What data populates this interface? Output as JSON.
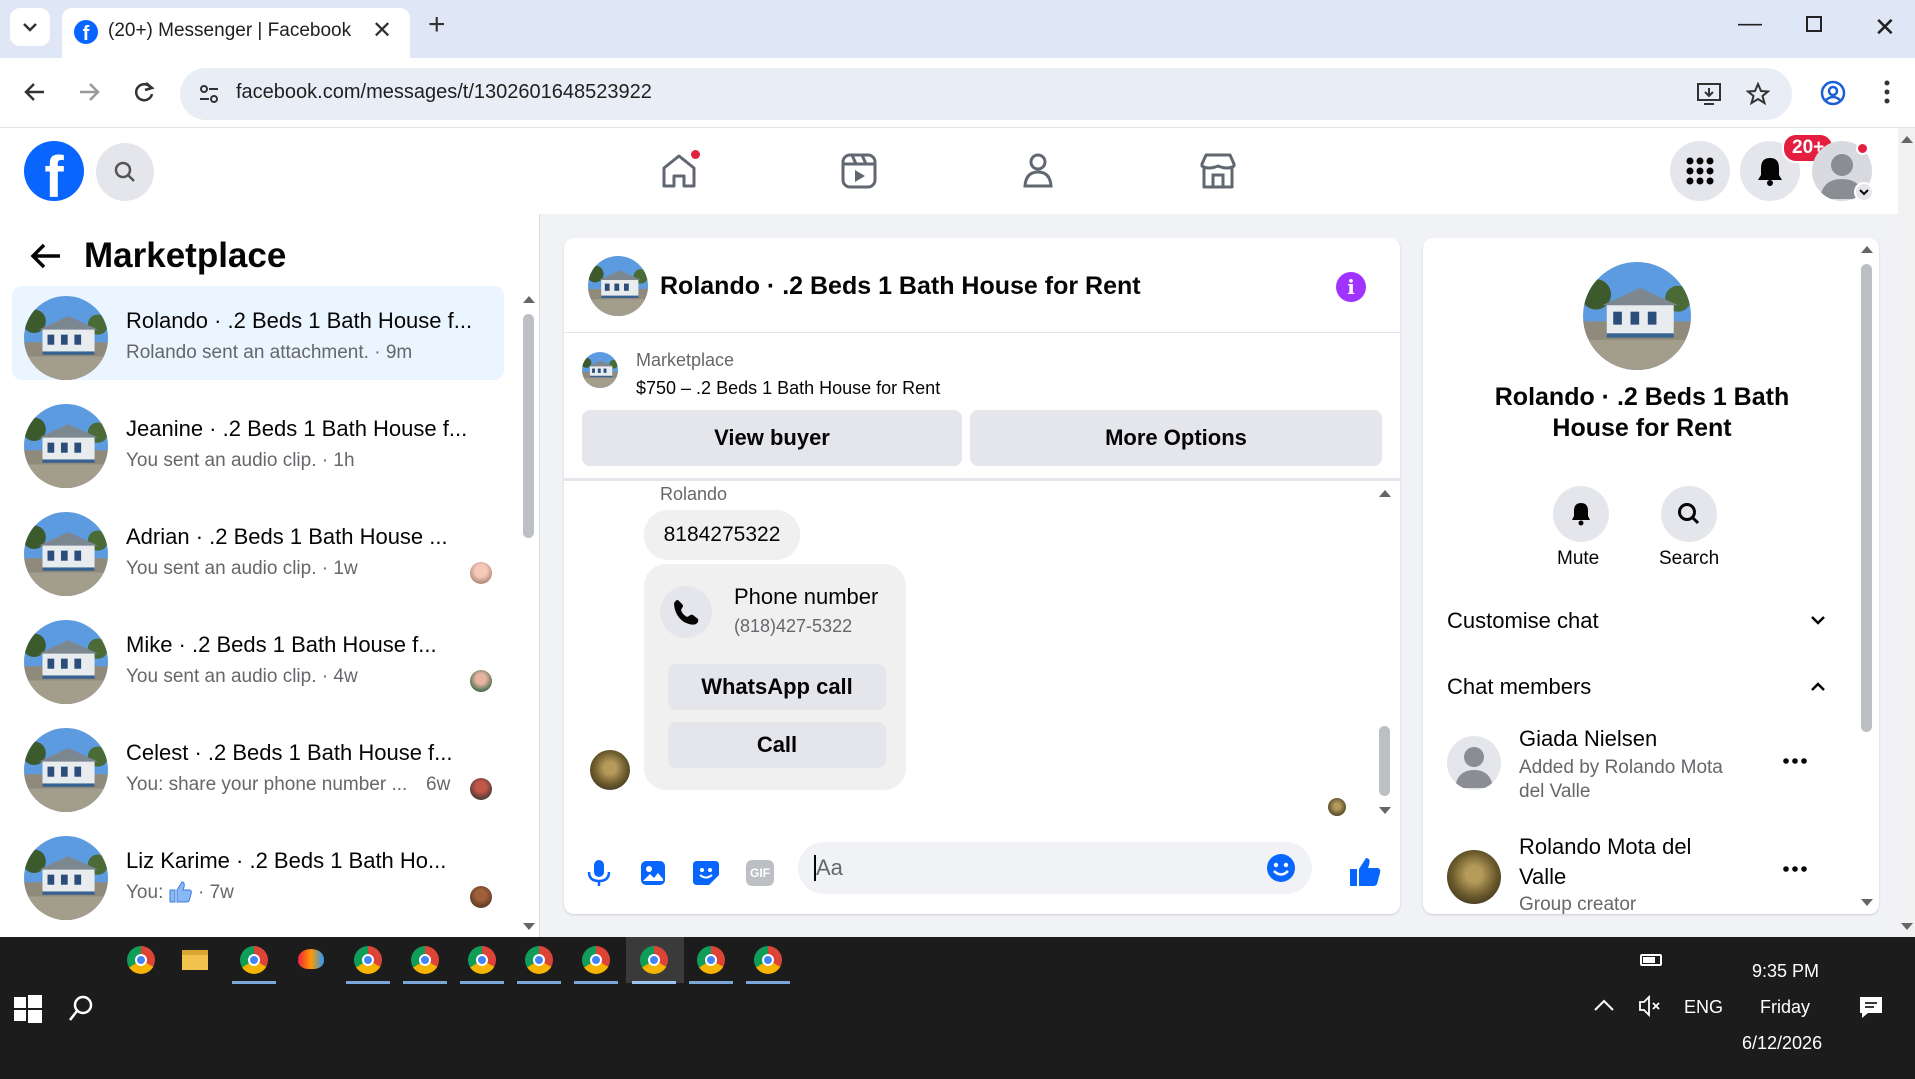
{
  "browser": {
    "tab_title": "(20+) Messenger | Facebook",
    "new_tab": "+",
    "url": "facebook.com/messages/t/1302601648523922"
  },
  "fb_header": {
    "notifications_badge": "20+"
  },
  "sidebar": {
    "title": "Marketplace",
    "conversations": [
      {
        "name": "Rolando · .2 Beds 1 Bath House f...",
        "snippet": "Rolando sent an attachment. · 9m"
      },
      {
        "name": "Jeanine · .2 Beds 1 Bath House f...",
        "snippet": "You sent an audio clip. · 1h"
      },
      {
        "name": "Adrian · .2 Beds 1 Bath House ...",
        "snippet": "You sent an audio clip. · 1w"
      },
      {
        "name": "Mike · .2 Beds 1 Bath House f...",
        "snippet": "You sent an audio clip. · 4w"
      },
      {
        "name": "Celest · .2 Beds 1 Bath House f...",
        "snippet": "You: share your phone number ...",
        "time": "6w"
      },
      {
        "name": "Liz Karime · .2 Beds 1 Bath Ho...",
        "snippet": "You:",
        "time": "· 7w"
      }
    ]
  },
  "chat": {
    "title": "Rolando · .2 Beds 1 Bath House for Rent",
    "listing_source": "Marketplace",
    "listing_text": "$750 – .2 Beds 1 Bath House for Rent",
    "view_buyer": "View buyer",
    "more_options": "More Options",
    "sender": "Rolando",
    "message": "8184275322",
    "card_title": "Phone number",
    "card_number": "(818)427-5322",
    "whatsapp_call": "WhatsApp call",
    "call": "Call",
    "composer_placeholder": "Aa",
    "gif_label": "GIF"
  },
  "info_panel": {
    "title": "Rolando · .2 Beds 1 Bath House for Rent",
    "mute": "Mute",
    "search": "Search",
    "customise_chat": "Customise chat",
    "chat_members": "Chat members",
    "members": [
      {
        "name": "Giada Nielsen",
        "detail": "Added by Rolando Mota del Valle"
      },
      {
        "name": "Rolando Mota del Valle",
        "detail": "Group creator"
      }
    ]
  },
  "taskbar": {
    "time": "9:35 PM",
    "day": "Friday",
    "date": "6/12/2026",
    "lang": "ENG"
  },
  "colors": {
    "fb_blue": "#0866ff",
    "messenger_purple": "#a033ff",
    "badge_red": "#e41e3f"
  }
}
